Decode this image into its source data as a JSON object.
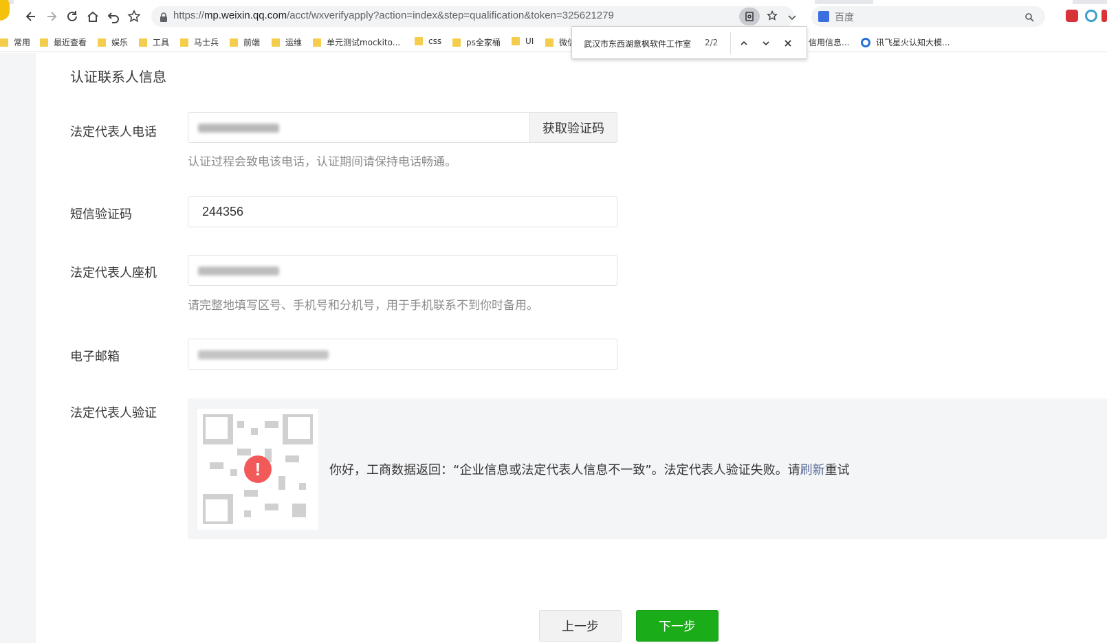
{
  "browser": {
    "url_prefix": "https://",
    "url_host": "mp.weixin.qq.com",
    "url_path": "/acct/wxverifyapply?action=index&step=qualification&token=325621279",
    "search_engine": "百度"
  },
  "bookmarks": [
    "常用",
    "最近查看",
    "娱乐",
    "工具",
    "马士兵",
    "前端",
    "运维",
    "单元测试mockito...",
    "css",
    "ps全家桶",
    "UI",
    "微信",
    "信用信息...",
    "讯飞星火认知大模..."
  ],
  "find_bar": {
    "query": "武汉市东西湖意枫软件工作室",
    "count": "2/2"
  },
  "form": {
    "section_title": "认证联系人信息",
    "phone": {
      "label": "法定代表人电话",
      "get_code_button": "获取验证码",
      "tip": "认证过程会致电该电话，认证期间请保持电话畅通。"
    },
    "sms_code": {
      "label": "短信验证码",
      "value": "244356"
    },
    "landline": {
      "label": "法定代表人座机",
      "tip": "请完整地填写区号、手机号和分机号，用于手机联系不到你时备用。"
    },
    "email": {
      "label": "电子邮箱"
    },
    "legal_verify": {
      "label": "法定代表人验证",
      "message_prefix": "你好，工商数据返回：“企业信息或法定代表人信息不一致”。法定代表人验证失败。请",
      "message_link": "刷新",
      "message_suffix": "重试"
    }
  },
  "buttons": {
    "prev": "上一步",
    "next": "下一步"
  },
  "colors": {
    "primary_green": "#1aad19",
    "error_red": "#f25a5a",
    "link_blue": "#576b95"
  }
}
